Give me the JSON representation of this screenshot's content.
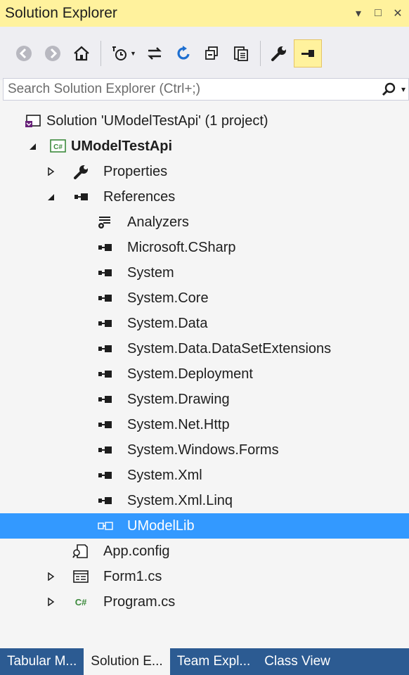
{
  "window": {
    "title": "Solution Explorer",
    "controls": {
      "dropdown": "▾",
      "maximize": "□",
      "close": "✕"
    }
  },
  "toolbar": {
    "buttons": [
      "back-icon",
      "forward-icon",
      "home-icon",
      "pending-changes-filter-icon",
      "sync-with-active-document-icon",
      "refresh-icon",
      "collapse-all-icon",
      "show-all-files-icon",
      "properties-icon",
      "pin-icon"
    ]
  },
  "search": {
    "placeholder": "Search Solution Explorer (Ctrl+;)",
    "dropdown": "▾"
  },
  "tree": {
    "items": [
      {
        "label": "Solution 'UModelTestApi' (1 project)",
        "icon": "solution-icon",
        "expander": "none",
        "level": 0
      },
      {
        "label": "UModelTestApi",
        "icon": "csharp-project-icon",
        "expander": "expanded",
        "level": 0,
        "bold": true
      },
      {
        "label": "Properties",
        "icon": "wrench-icon",
        "expander": "collapsed",
        "level": 1
      },
      {
        "label": "References",
        "icon": "references-icon",
        "expander": "expanded",
        "level": 1
      },
      {
        "label": "Analyzers",
        "icon": "analyzers-icon",
        "expander": "none",
        "level": 2
      },
      {
        "label": "Microsoft.CSharp",
        "icon": "assembly-reference-icon",
        "expander": "none",
        "level": 2
      },
      {
        "label": "System",
        "icon": "assembly-reference-icon",
        "expander": "none",
        "level": 2
      },
      {
        "label": "System.Core",
        "icon": "assembly-reference-icon",
        "expander": "none",
        "level": 2
      },
      {
        "label": "System.Data",
        "icon": "assembly-reference-icon",
        "expander": "none",
        "level": 2
      },
      {
        "label": "System.Data.DataSetExtensions",
        "icon": "assembly-reference-icon",
        "expander": "none",
        "level": 2
      },
      {
        "label": "System.Deployment",
        "icon": "assembly-reference-icon",
        "expander": "none",
        "level": 2
      },
      {
        "label": "System.Drawing",
        "icon": "assembly-reference-icon",
        "expander": "none",
        "level": 2
      },
      {
        "label": "System.Net.Http",
        "icon": "assembly-reference-icon",
        "expander": "none",
        "level": 2
      },
      {
        "label": "System.Windows.Forms",
        "icon": "assembly-reference-icon",
        "expander": "none",
        "level": 2
      },
      {
        "label": "System.Xml",
        "icon": "assembly-reference-icon",
        "expander": "none",
        "level": 2
      },
      {
        "label": "System.Xml.Linq",
        "icon": "assembly-reference-icon",
        "expander": "none",
        "level": 2
      },
      {
        "label": "UModelLib",
        "icon": "project-reference-icon",
        "expander": "none",
        "level": 2,
        "selected": true
      },
      {
        "label": "App.config",
        "icon": "config-file-icon",
        "expander": "none",
        "level": 1
      },
      {
        "label": "Form1.cs",
        "icon": "form-icon",
        "expander": "collapsed",
        "level": 1
      },
      {
        "label": "Program.cs",
        "icon": "csharp-file-icon",
        "expander": "collapsed",
        "level": 1
      }
    ]
  },
  "tabs": [
    {
      "label": "Tabular M...",
      "active": false
    },
    {
      "label": "Solution E...",
      "active": true
    },
    {
      "label": "Team Expl...",
      "active": false
    },
    {
      "label": "Class View",
      "active": false
    }
  ],
  "colors": {
    "title_bar": "#fff29d",
    "selection": "#3399ff",
    "tab_strip": "#2c5b92",
    "background": "#f5f5f5"
  }
}
